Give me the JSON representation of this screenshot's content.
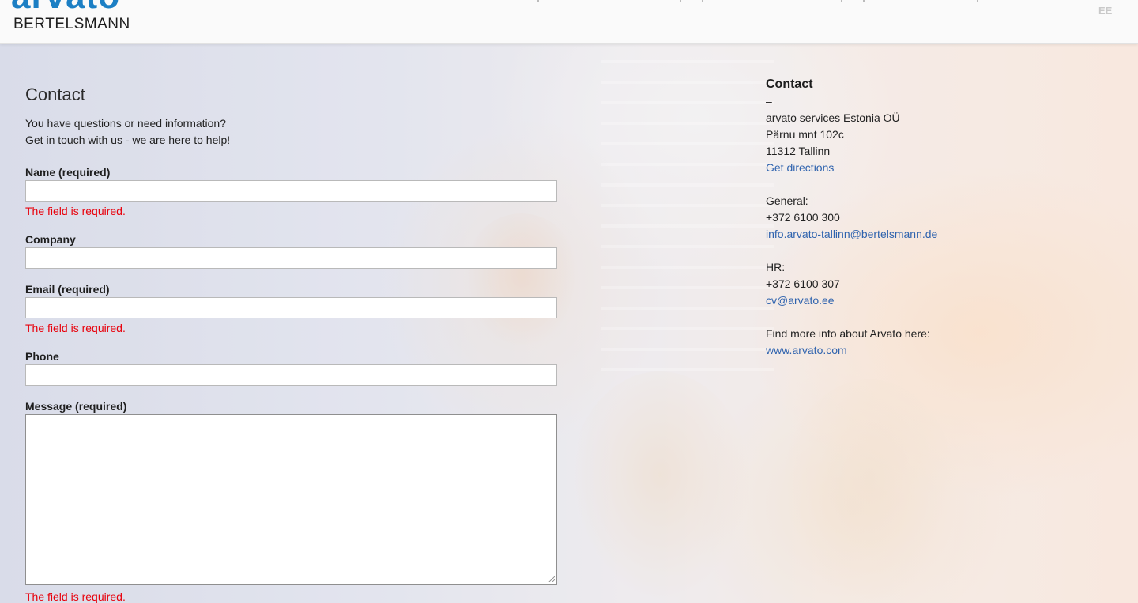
{
  "header": {
    "logo_top": "arvato",
    "logo_bottom": "BERTELSMANN",
    "language": "EE"
  },
  "form": {
    "title": "Contact",
    "intro_line1": "You have questions or need information?",
    "intro_line2": "Get in touch with us - we are here to help!",
    "fields": [
      {
        "label": "Name (required)",
        "value": "",
        "error": "The field is required."
      },
      {
        "label": "Company",
        "value": ""
      },
      {
        "label": "Email (required)",
        "value": "",
        "error": "The field is required."
      },
      {
        "label": "Phone",
        "value": ""
      },
      {
        "label": "Message (required)",
        "value": "",
        "error": "The field is required."
      }
    ]
  },
  "contact": {
    "title": "Contact",
    "dash": "–",
    "company": "arvato services Estonia OÜ",
    "street": "Pärnu mnt 102c",
    "city": "11312 Tallinn",
    "directions_link": "Get directions",
    "general_label": "General:",
    "general_phone": "+372 6100 300",
    "general_email": "info.arvato-tallinn@bertelsmann.de",
    "hr_label": "HR:",
    "hr_phone": "+372 6100 307",
    "hr_email": "cv@arvato.ee",
    "more_info": "Find more info about Arvato here:",
    "website": "www.arvato.com"
  },
  "colors": {
    "accent": "#1c7fc4",
    "link": "#2f63ae",
    "error": "#e8000b"
  }
}
